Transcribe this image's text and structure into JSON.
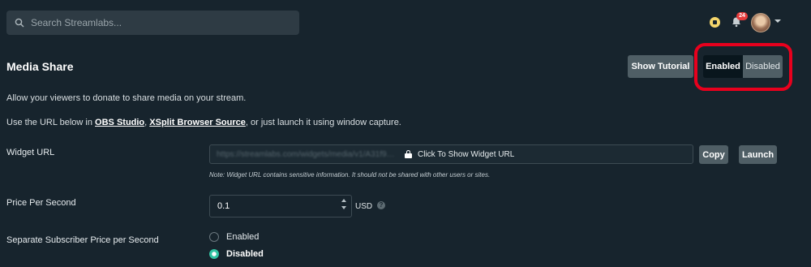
{
  "search": {
    "placeholder": "Search Streamlabs..."
  },
  "header": {
    "notification_count": "24"
  },
  "page": {
    "title": "Media Share",
    "show_tutorial_label": "Show Tutorial",
    "toggle": {
      "enabled_label": "Enabled",
      "disabled_label": "Disabled",
      "active": "Enabled"
    },
    "highlight_color": "#e8001d"
  },
  "description": {
    "line1": "Allow your viewers to donate to share media on your stream.",
    "line2_prefix": "Use the URL below in ",
    "obs_link": "OBS Studio",
    "sep": ", ",
    "xsplit_link": "XSplit Browser Source",
    "line2_suffix": ", or just launch it using window capture."
  },
  "widget_url": {
    "label": "Widget URL",
    "blurred_url": "https://streamlabs.com/widgets/media/v1/A31f9…",
    "click_text": "Click To Show Widget URL",
    "copy_label": "Copy",
    "launch_label": "Launch",
    "note": "Note: Widget URL contains sensitive information. It should not be shared with other users or sites."
  },
  "price": {
    "label": "Price Per Second",
    "value": "0.1",
    "currency": "USD"
  },
  "subscriber_price": {
    "label": "Separate Subscriber Price per Second",
    "options": [
      "Enabled",
      "Disabled"
    ],
    "selected": "Disabled"
  },
  "colors": {
    "background": "#17242d",
    "accent": "#31c3a2",
    "button": "#4f5e65"
  }
}
